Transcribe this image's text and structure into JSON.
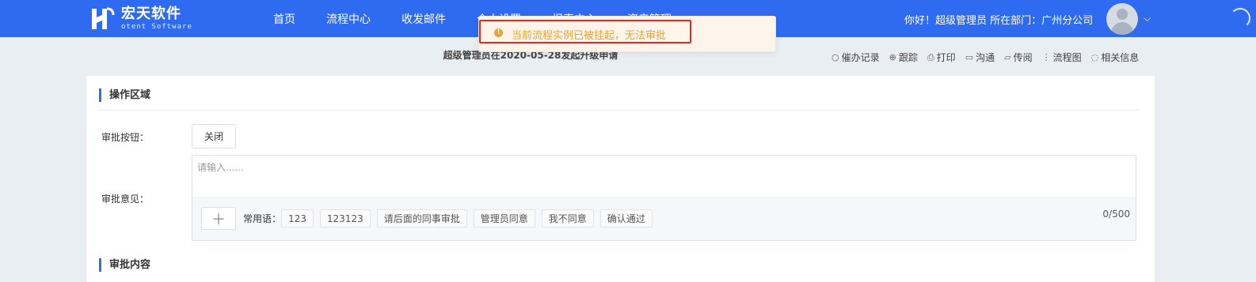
{
  "header": {
    "logo_cn": "宏天软件",
    "logo_en": "otent Software",
    "nav": [
      "首页",
      "流程中心",
      "收发邮件",
      "个人设置",
      "报表中心",
      "资产管理"
    ],
    "greeting": "你好！超级管理员 所在部门：广州分公司"
  },
  "alert": {
    "message": "当前流程实例已被挂起，无法审批",
    "type": "warning",
    "color": "#e6a23c"
  },
  "document": {
    "title": "超级管理员在2020-05-28发起升级申请"
  },
  "toolbar": [
    {
      "icon": "search-icon",
      "label": "催办记录"
    },
    {
      "icon": "target-icon",
      "label": "跟踪"
    },
    {
      "icon": "print-icon",
      "label": "打印"
    },
    {
      "icon": "chat-icon",
      "label": "沟通"
    },
    {
      "icon": "folder-icon",
      "label": "传阅"
    },
    {
      "icon": "flowchart-icon",
      "label": "流程图"
    },
    {
      "icon": "comment-icon",
      "label": "相关信息"
    }
  ],
  "operation": {
    "section_title": "操作区域",
    "buttons_label": "审批按钮：",
    "close_button": "关闭",
    "opinion_label": "审批意见：",
    "opinion_placeholder": "请输入......",
    "add_symbol": "＋",
    "common_label": "常用语：",
    "phrases": [
      "123",
      "123123",
      "请后面的同事审批",
      "管理员同意",
      "我不同意",
      "确认通过"
    ],
    "counter": "0/500"
  },
  "content": {
    "section_title": "审批内容"
  },
  "colors": {
    "primary": "#2f6bf0",
    "alert_border": "#e8261f"
  }
}
